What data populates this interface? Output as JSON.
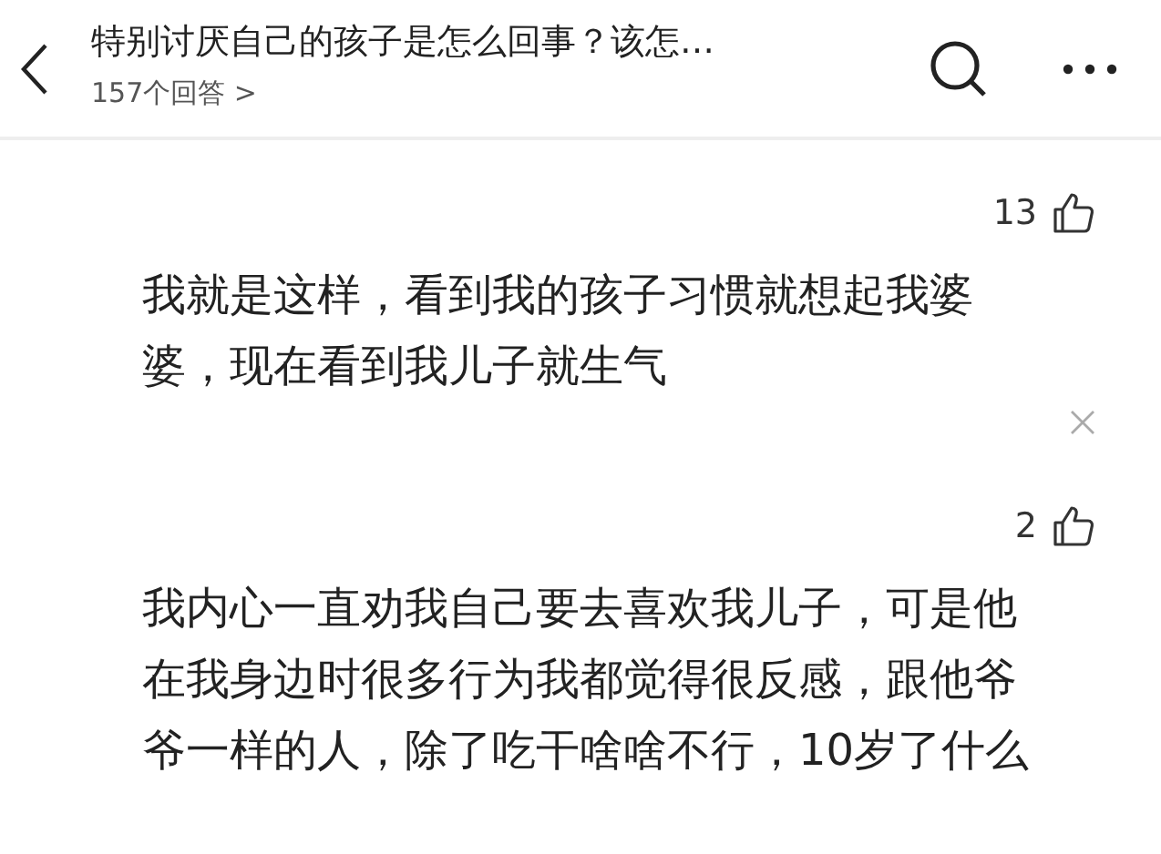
{
  "header": {
    "title": "特别讨厌自己的孩子是怎么回事？该怎…",
    "answer_count": "157个回答 >"
  },
  "answers": [
    {
      "likes": "13",
      "text": "我就是这样，看到我的孩子习惯就想起我婆婆，现在看到我儿子就生气",
      "dismissable": true
    },
    {
      "likes": "2",
      "text": "我内心一直劝我自己要去喜欢我儿子，可是他在我身边时很多行为我都觉得很反感，跟他爷爷一样的人，除了吃干啥啥不行，10岁了什么",
      "dismissable": false
    }
  ]
}
